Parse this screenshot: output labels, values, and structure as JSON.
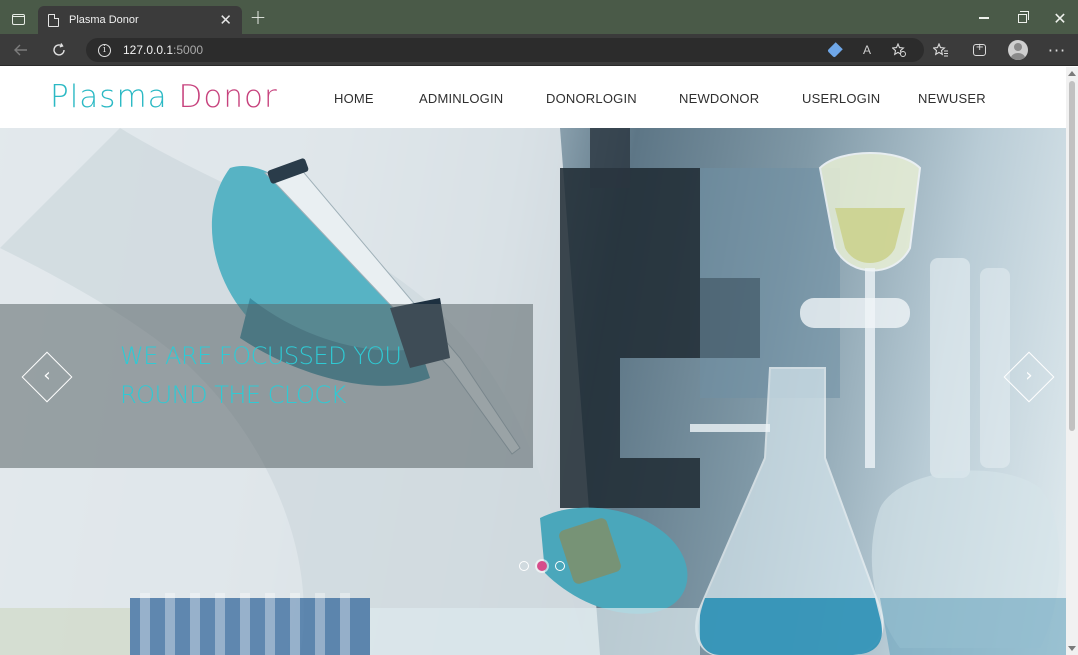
{
  "browser": {
    "tab_title": "Plasma Donor",
    "tab_close": "✕",
    "new_tab": "+",
    "url_host": "127.0.0.1",
    "url_port": ":5000",
    "read_aloud": "A",
    "more": "···",
    "window_close": "✕",
    "icons": [
      "tab-actions-icon",
      "page-icon",
      "back-icon",
      "refresh-icon",
      "info-icon",
      "tag-icon",
      "read-aloud-icon",
      "add-favorite-icon",
      "favorites-icon",
      "collections-icon",
      "profile-icon",
      "more-icon"
    ]
  },
  "site": {
    "logo_part1": "Plasma",
    "logo_part2": "Donor",
    "nav": [
      "HOME",
      "ADMINLOGIN",
      "DONORLOGIN",
      "NEWDONOR",
      "USERLOGIN",
      "NEWUSER"
    ],
    "colors": {
      "logo_teal": "#2bb9c4",
      "logo_pink": "#c7427d",
      "caption": "#2fcad4",
      "active_dot": "#d64d8b"
    }
  },
  "hero": {
    "caption_line1": "WE ARE FOCUSSED YOU",
    "caption_line2": "ROUND THE CLOCK",
    "prev_arrow": "‹",
    "next_arrow": "›",
    "slides_count": 3,
    "active_slide": 2
  }
}
